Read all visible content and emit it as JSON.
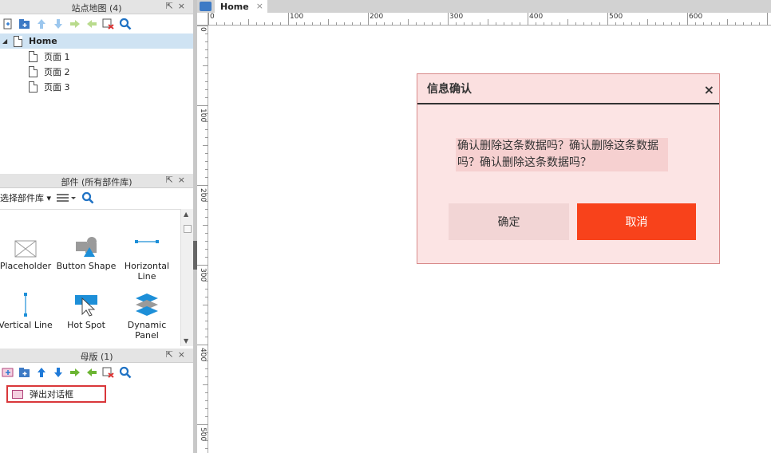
{
  "sitemap": {
    "title": "站点地图 (4)",
    "pin": "⇱",
    "close": "×",
    "root": "Home",
    "pages": [
      "页面 1",
      "页面 2",
      "页面 3"
    ]
  },
  "widgets": {
    "title": "部件 (所有部件库)",
    "pin": "⇱",
    "close": "×",
    "library_select": "选择部件库 ▾",
    "items": [
      {
        "label": "Placeholder",
        "icon": "placeholder-icon"
      },
      {
        "label": "Button Shape",
        "icon": "button-shape-icon"
      },
      {
        "label": "Horizontal Line",
        "icon": "horizontal-line-icon"
      },
      {
        "label": "Vertical Line",
        "icon": "vertical-line-icon"
      },
      {
        "label": "Hot Spot",
        "icon": "hot-spot-icon"
      },
      {
        "label": "Dynamic Panel",
        "icon": "dynamic-panel-icon"
      }
    ]
  },
  "masters": {
    "title": "母版 (1)",
    "pin": "⇱",
    "close": "×",
    "items": [
      "弹出对话框"
    ]
  },
  "editor": {
    "tab_label": "Home",
    "tab_close": "×",
    "ruler_h": [
      "0",
      "100",
      "200",
      "300",
      "400",
      "500",
      "600"
    ],
    "ruler_v": [
      "0",
      "100",
      "200",
      "300",
      "400",
      "500"
    ]
  },
  "dialog": {
    "title": "信息确认",
    "close": "×",
    "message": "确认删除这条数据吗？确认删除这条数据吗？确认删除这条数据吗？",
    "ok_label": "确定",
    "cancel_label": "取消",
    "colors": {
      "bg": "#fce4e4",
      "cancel": "#f8421b",
      "ok": "#f2d5d5"
    }
  }
}
